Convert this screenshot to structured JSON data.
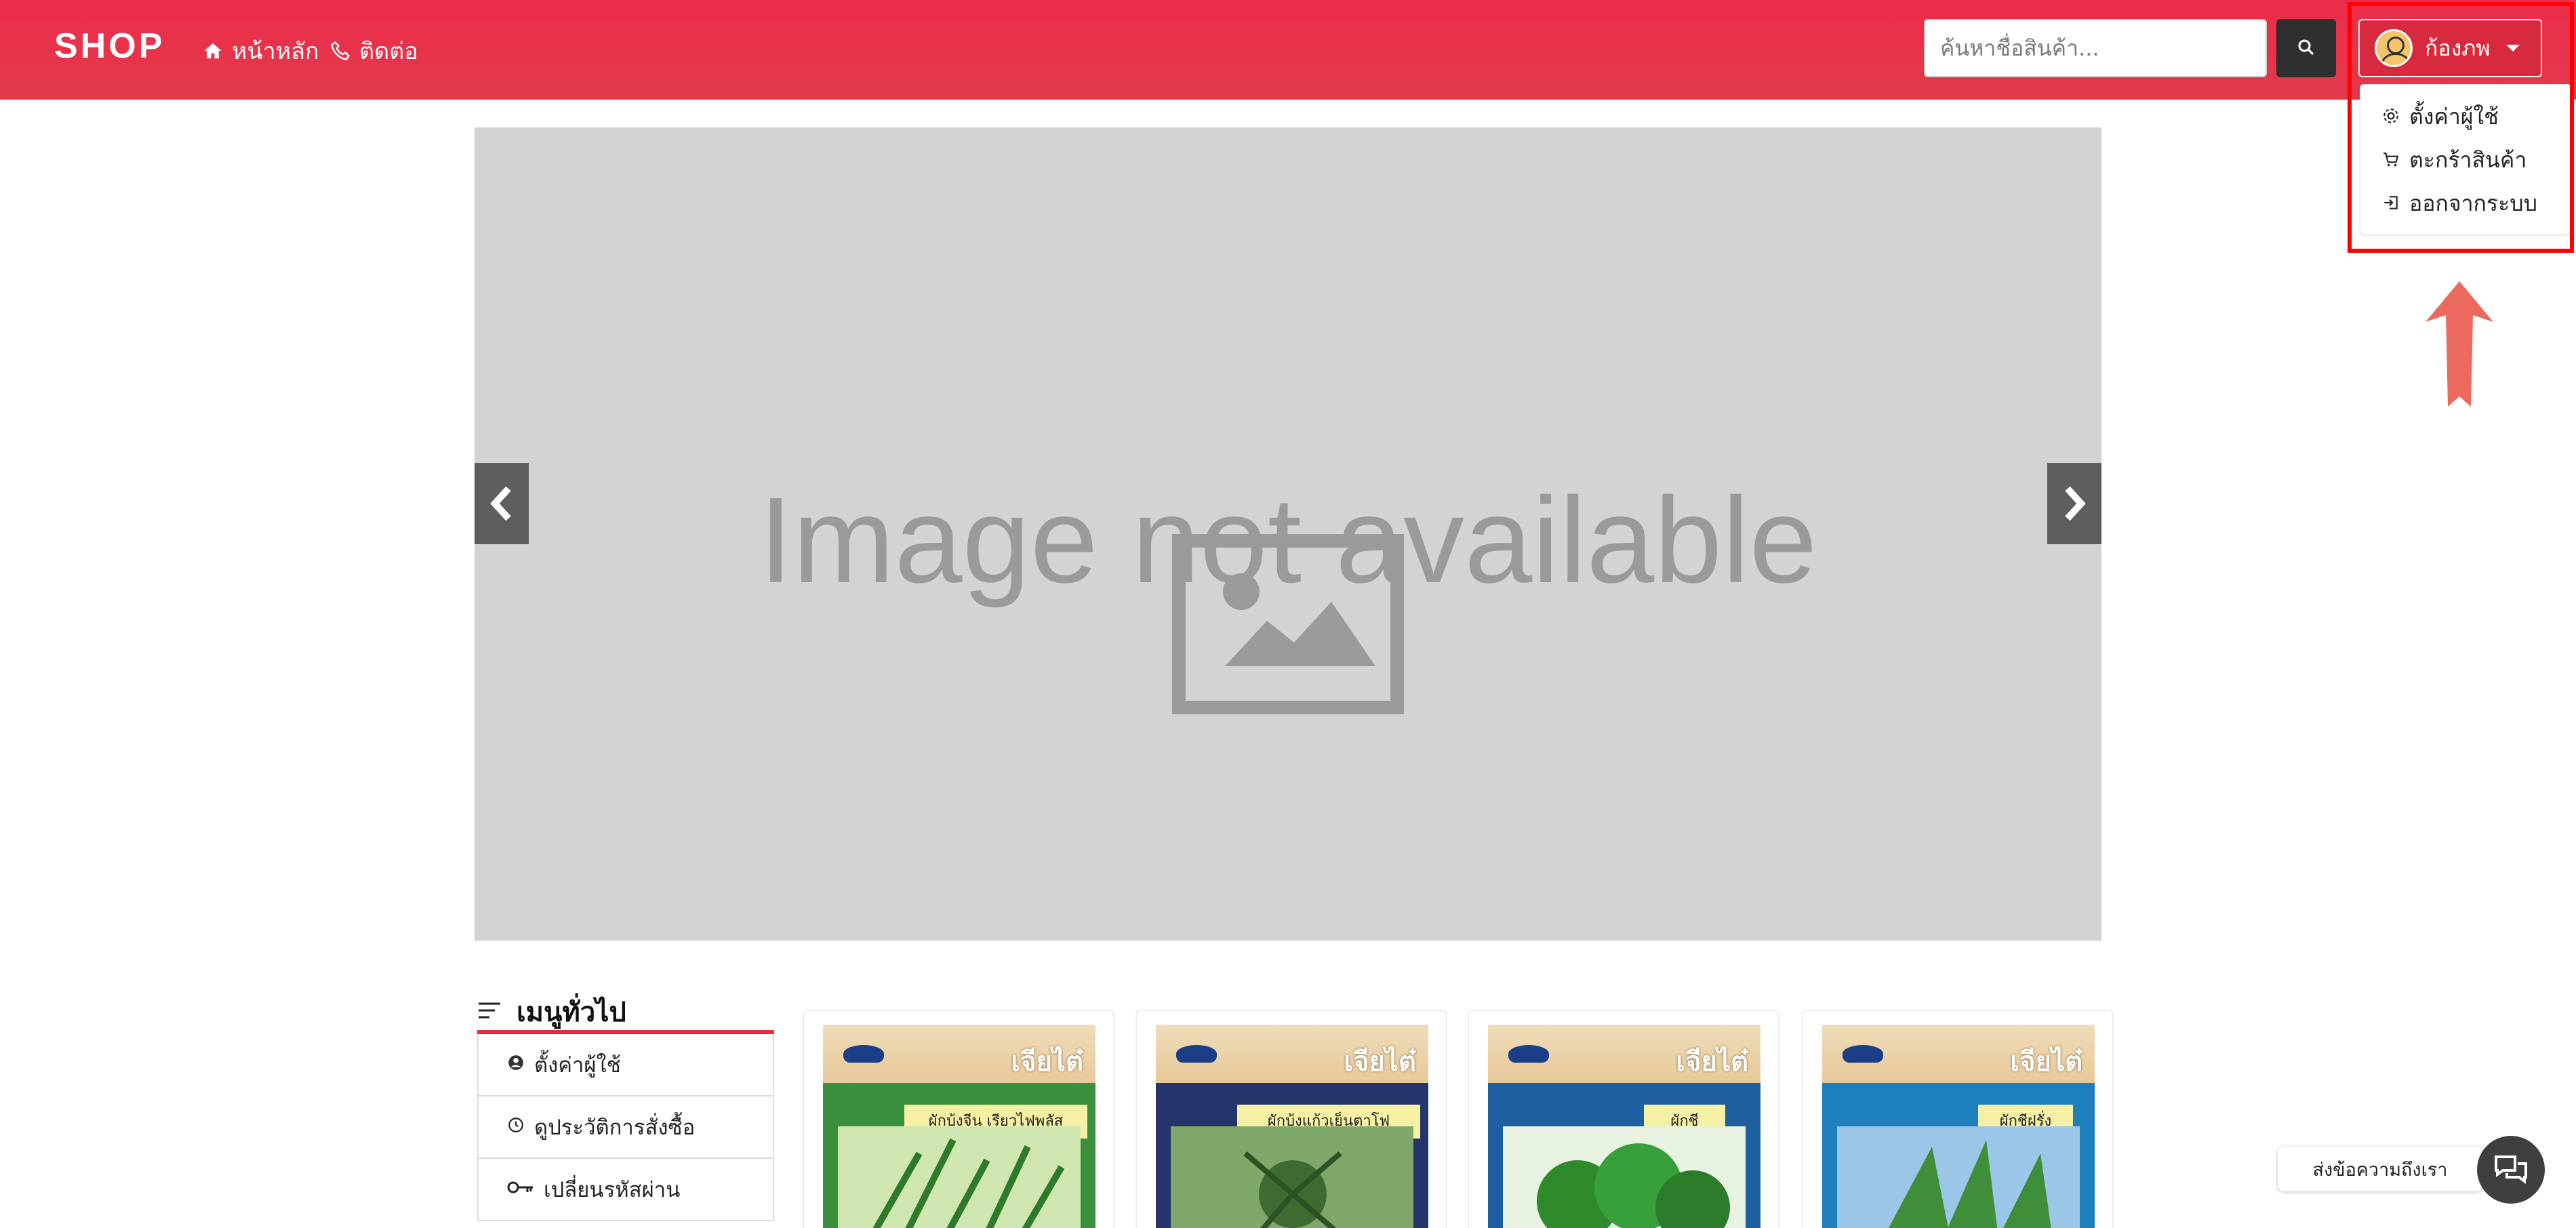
{
  "navbar": {
    "brand": "SHOP",
    "links": [
      {
        "label": "หน้าหลัก",
        "icon": "home-icon"
      },
      {
        "label": "ติดต่อ",
        "icon": "phone-icon"
      }
    ],
    "search_placeholder": "ค้นหาชื่อสินค้า...",
    "user_name": "ก้องภพ",
    "bg_color": "#ea2f49"
  },
  "user_menu": {
    "items": [
      {
        "label": "ตั้งค่าผู้ใช้",
        "icon": "gear-icon"
      },
      {
        "label": "ตะกร้าสินค้า",
        "icon": "cart-icon"
      },
      {
        "label": "ออกจากระบบ",
        "icon": "logout-icon"
      }
    ]
  },
  "carousel": {
    "placeholder_text": "Image not available"
  },
  "sidebar": {
    "title": "เมนูทั่วไป",
    "items": [
      {
        "label": "ตั้งค่าผู้ใช้",
        "icon": "user-circle-icon"
      },
      {
        "label": "ดูประวัติการสั่งซื้อ",
        "icon": "history-icon"
      },
      {
        "label": "เปลี่ยนรหัสผ่าน",
        "icon": "key-icon"
      }
    ]
  },
  "products": [
    {
      "brand": "เจียไต๋",
      "label": "ผักบุ้งจีน เรียวไฟพลัส",
      "color": "#3a8f3a"
    },
    {
      "brand": "เจียไต๋",
      "label": "ผักบุ้งแก้วเย็นตาโฟ",
      "color": "#27346b"
    },
    {
      "brand": "เจียไต๋",
      "label": "ผักชี",
      "color": "#1e5fa0"
    },
    {
      "brand": "เจียไต๋",
      "label": "ผักชีฝรั่ง",
      "color": "#1e7fbf"
    }
  ],
  "chat": {
    "label": "ส่งข้อความถึงเรา"
  }
}
